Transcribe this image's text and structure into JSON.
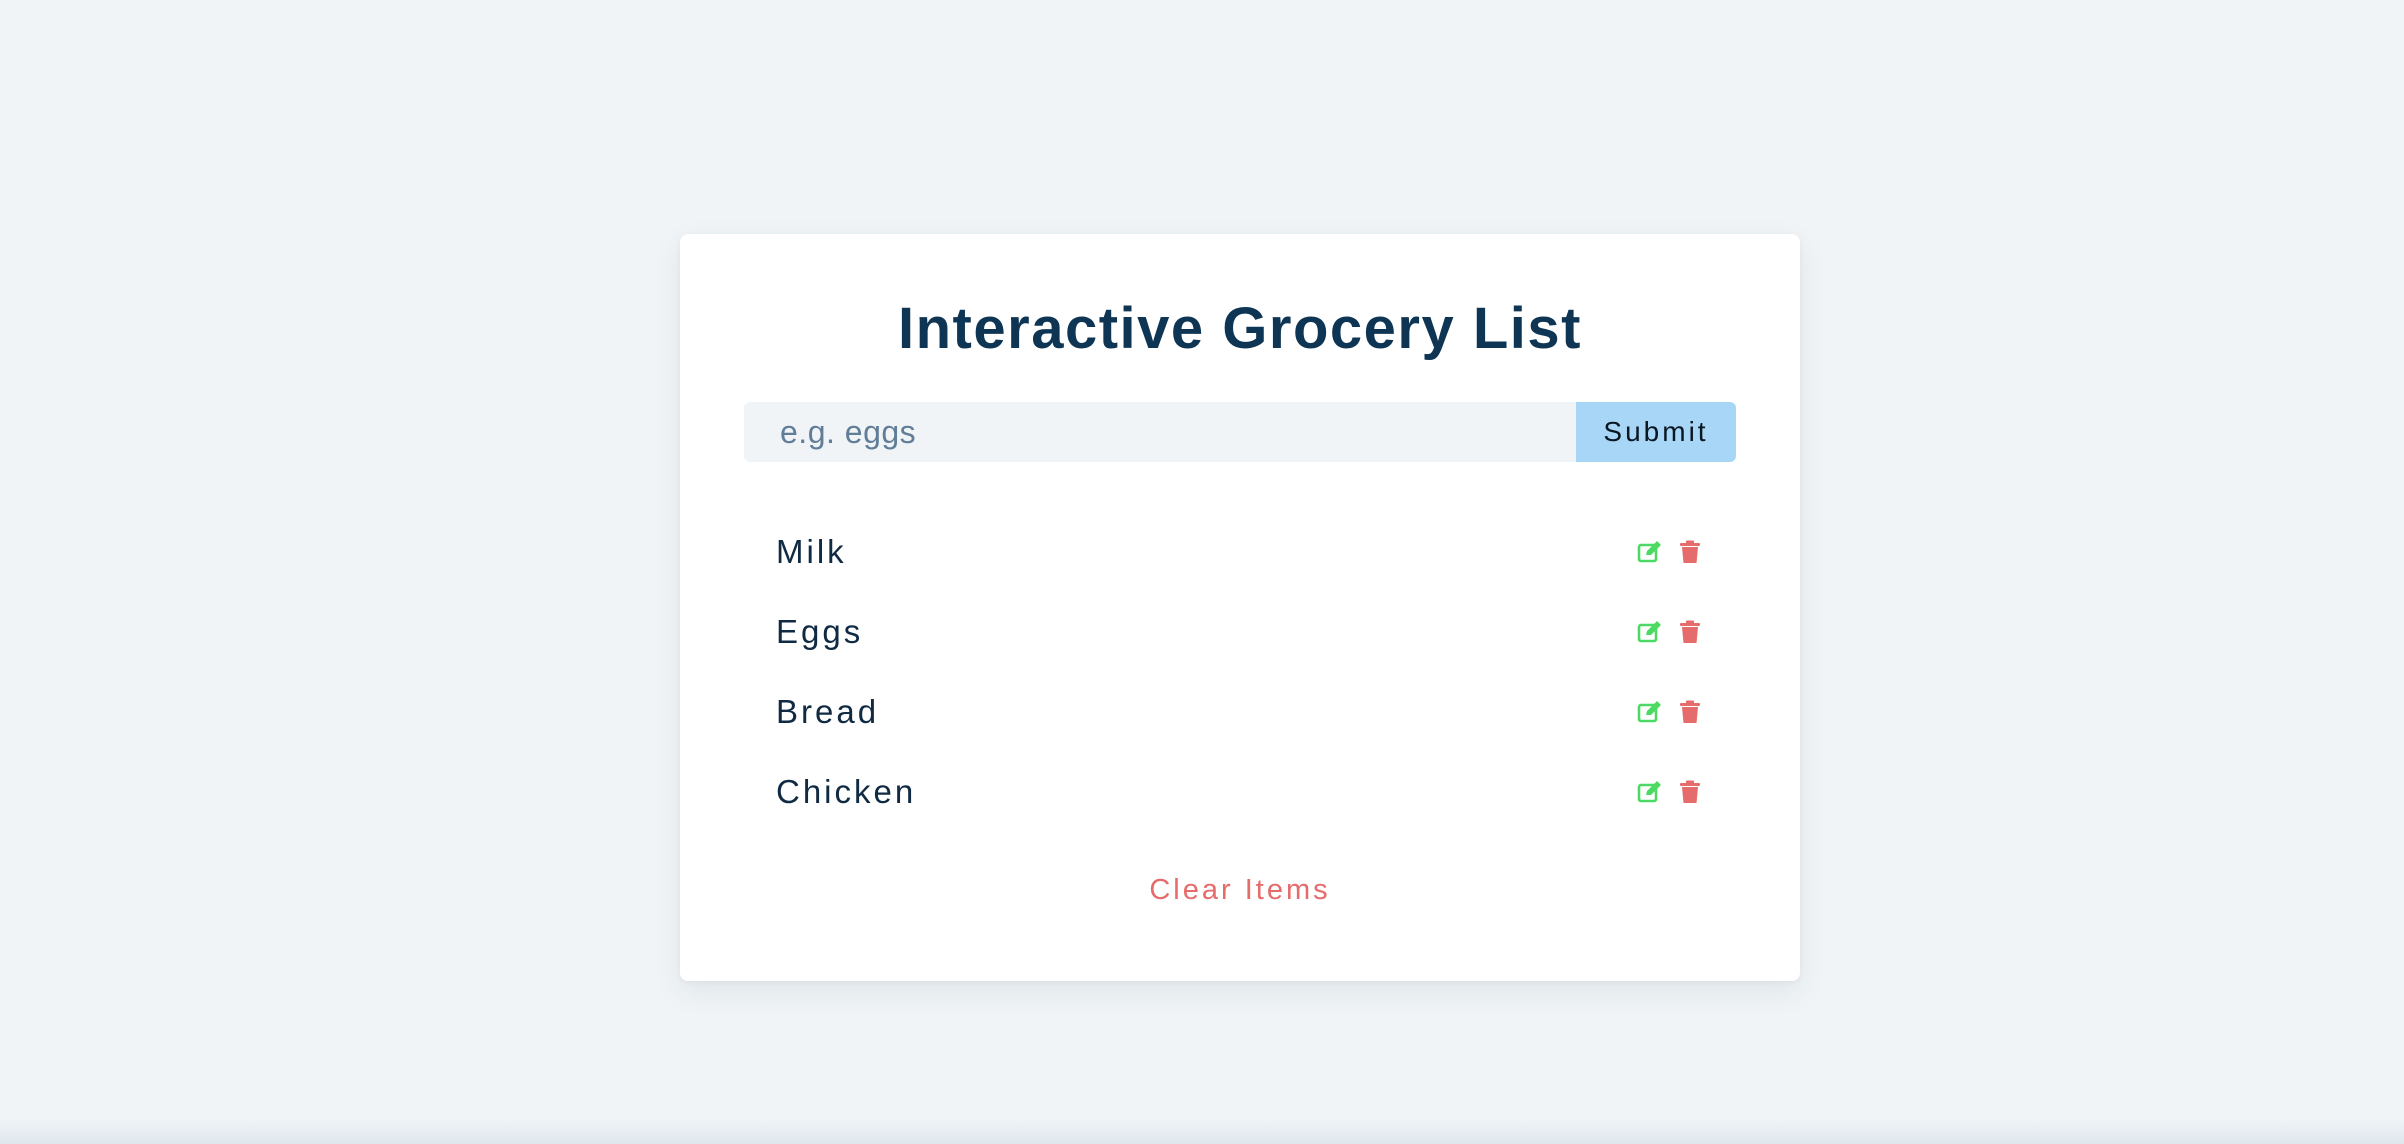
{
  "title": "Interactive Grocery List",
  "form": {
    "input_value": "",
    "placeholder": "e.g. eggs",
    "submit_label": "Submit"
  },
  "items": [
    {
      "name": "Milk",
      "edit_icon": "edit-icon",
      "delete_icon": "trash-icon"
    },
    {
      "name": "Eggs",
      "edit_icon": "edit-icon",
      "delete_icon": "trash-icon"
    },
    {
      "name": "Bread",
      "edit_icon": "edit-icon",
      "delete_icon": "trash-icon"
    },
    {
      "name": "Chicken",
      "edit_icon": "edit-icon",
      "delete_icon": "trash-icon"
    }
  ],
  "clear_label": "Clear Items",
  "colors": {
    "background": "#f0f4f7",
    "title": "#0e3553",
    "submit": "#a7d6f6",
    "edit_icon": "#4cd964",
    "delete_icon": "#e66b6b",
    "clear_text": "#e66b6b"
  }
}
